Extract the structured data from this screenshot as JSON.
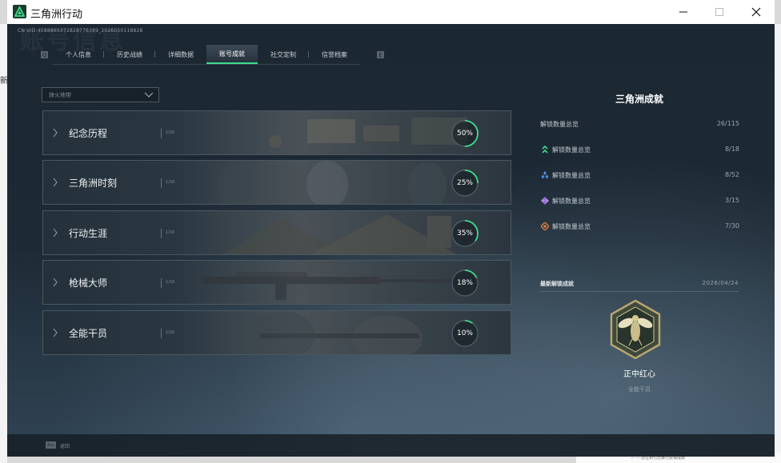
{
  "window": {
    "title": "三角洲行动",
    "controls": {
      "minimize": "minimize-icon",
      "maximize": "maximize-icon",
      "close": "close-icon"
    }
  },
  "game": {
    "uid_line": "CN UID:4588865372828776389_2026050118828",
    "bg_watermark": "账号信息",
    "tabs": [
      {
        "label": "个人信息",
        "active": false
      },
      {
        "label": "历史战绩",
        "active": false
      },
      {
        "label": "详细数据",
        "active": false
      },
      {
        "label": "账号成就",
        "active": true
      },
      {
        "label": "社交定制",
        "active": false
      },
      {
        "label": "信誉档案",
        "active": false
      }
    ],
    "tab_prev_key": "Q",
    "tab_next_key": "E",
    "filter": {
      "value": "烽火地带"
    },
    "categories": [
      {
        "label": "纪念历程",
        "faint": "1/16",
        "percent": 50
      },
      {
        "label": "三角洲时刻",
        "faint": "1/16",
        "percent": 25
      },
      {
        "label": "行动生涯",
        "faint": "1/16",
        "percent": 35
      },
      {
        "label": "枪械大师",
        "faint": "1/16",
        "percent": 18
      },
      {
        "label": "全能干员",
        "faint": "1/16",
        "percent": 10
      }
    ],
    "panel": {
      "title": "三角洲成就",
      "total": {
        "label": "解锁数量总览",
        "value": "26/115"
      },
      "stats": [
        {
          "icon": "green-chevrons-icon",
          "color": "#3fdc8e",
          "label": "解锁数量总览",
          "value": "8/18"
        },
        {
          "icon": "blue-diamonds-icon",
          "color": "#4a90e2",
          "label": "解锁数量总览",
          "value": "8/52"
        },
        {
          "icon": "purple-diamonds-icon",
          "color": "#9b6be0",
          "label": "解锁数量总览",
          "value": "3/15"
        },
        {
          "icon": "orange-compass-icon",
          "color": "#e07a3c",
          "label": "解锁数量总览",
          "value": "7/30"
        }
      ],
      "latest": {
        "label": "最新解锁成就",
        "date": "2026/04/24"
      },
      "medal": {
        "name": "正中红心",
        "category": "全能干员",
        "icon": "hornet-medal-icon"
      }
    },
    "footer": {
      "key": "Esc",
      "label": "返回"
    }
  },
  "desktop": {
    "left_chars": [
      "新",
      "·",
      "·",
      "·"
    ],
    "bottom_note": "— —  前往到付比赛行获得成就"
  }
}
